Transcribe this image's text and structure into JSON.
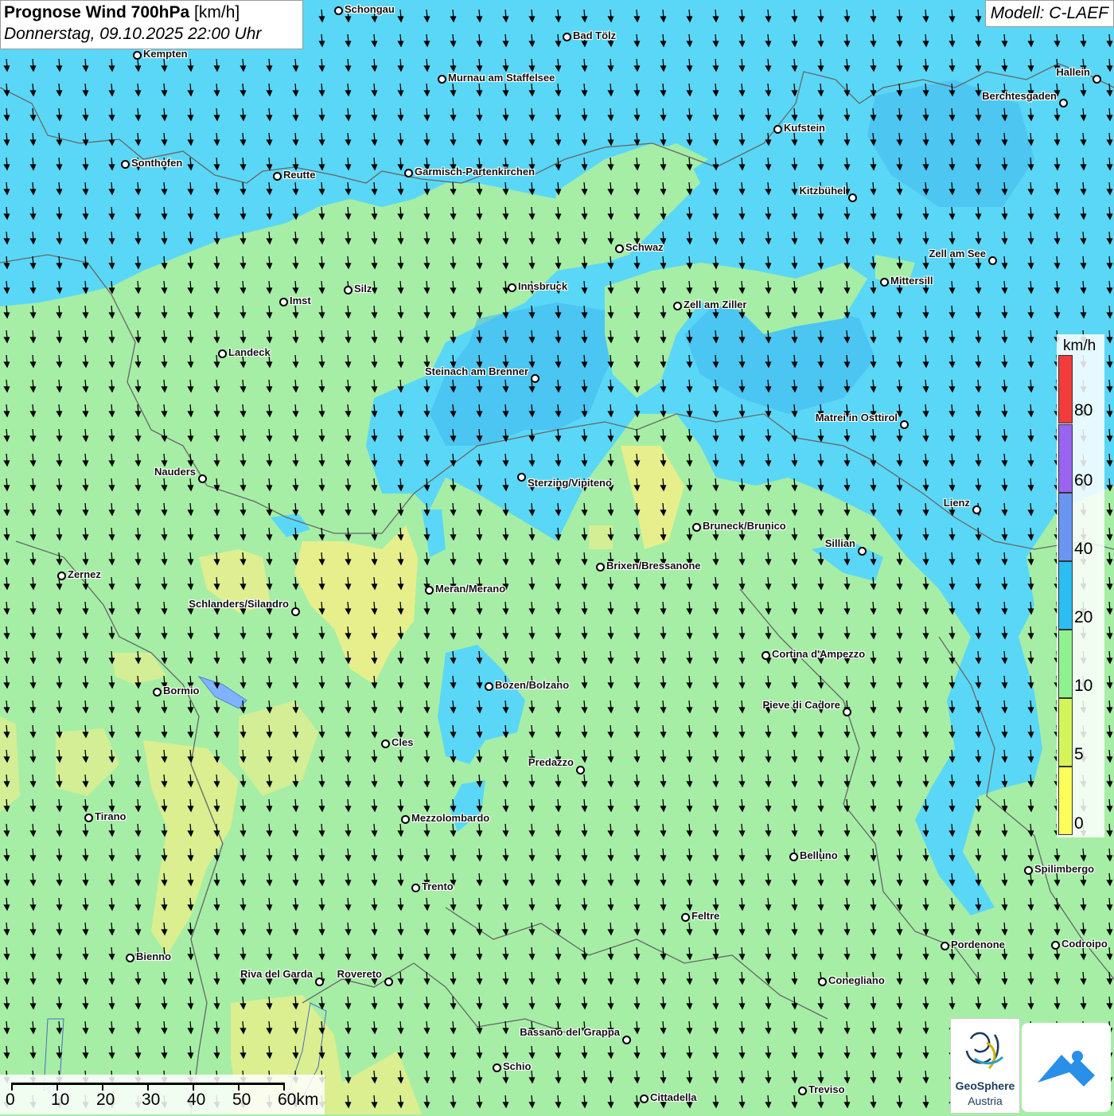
{
  "header": {
    "title_bold": "Prognose Wind 700hPa",
    "title_unit": " [km/h]",
    "datetime": "Donnerstag, 09.10.2025 22:00 Uhr",
    "model": "Modell: C-LAEF"
  },
  "legend": {
    "unit": "km/h",
    "ticks": [
      "80",
      "60",
      "40",
      "20",
      "10",
      "5",
      "0"
    ],
    "colors": [
      "#f23c3c",
      "#9a63f0",
      "#6a96f2",
      "#2bbef2",
      "#8ff28f",
      "#d4f55a",
      "#ffff5a"
    ]
  },
  "scalebar": {
    "labels": [
      "0",
      "10",
      "20",
      "30",
      "40",
      "50",
      "60km"
    ]
  },
  "logos": {
    "geosphere_line1": "GeoSphere",
    "geosphere_line2": "Austria"
  },
  "colors": {
    "calm_yellow": "#f2ee88",
    "light_green": "#a6eea6",
    "sky_blue": "#5ad7f7",
    "mid_blue": "#3fb6ee",
    "border_gray": "#666666",
    "arrow": "#000000"
  },
  "wind_direction": "north-to-south",
  "cities": [
    {
      "name": "Schongau"
    },
    {
      "name": "Bad Tölz"
    },
    {
      "name": "Kempten"
    },
    {
      "name": "Murnau am Staffelsee"
    },
    {
      "name": "Hallein"
    },
    {
      "name": "Berchtesgaden"
    },
    {
      "name": "Kufstein"
    },
    {
      "name": "Sonthofen"
    },
    {
      "name": "Reutte"
    },
    {
      "name": "Garmisch-Partenkirchen"
    },
    {
      "name": "Kitzbühel"
    },
    {
      "name": "Schwaz"
    },
    {
      "name": "Zell am See"
    },
    {
      "name": "Mittersill"
    },
    {
      "name": "Innsbruck"
    },
    {
      "name": "Silz"
    },
    {
      "name": "Imst"
    },
    {
      "name": "Zell am Ziller"
    },
    {
      "name": "Landeck"
    },
    {
      "name": "Steinach am Brenner"
    },
    {
      "name": "Matrei in Osttirol"
    },
    {
      "name": "Nauders"
    },
    {
      "name": "Sterzing/Vipiteno"
    },
    {
      "name": "Lienz"
    },
    {
      "name": "Bruneck/Brunico"
    },
    {
      "name": "Sillian"
    },
    {
      "name": "Brixen/Bressanone"
    },
    {
      "name": "Zernez"
    },
    {
      "name": "Meran/Merano"
    },
    {
      "name": "Schlanders/Silandro"
    },
    {
      "name": "Cortina d'Ampezzo"
    },
    {
      "name": "Bozen/Bolzano"
    },
    {
      "name": "Bormio"
    },
    {
      "name": "Pieve di Cadore"
    },
    {
      "name": "Cles"
    },
    {
      "name": "Predazzo"
    },
    {
      "name": "Tirano"
    },
    {
      "name": "Mezzolombardo"
    },
    {
      "name": "Belluno"
    },
    {
      "name": "Spilimbergo"
    },
    {
      "name": "Trento"
    },
    {
      "name": "Feltre"
    },
    {
      "name": "Pordenone"
    },
    {
      "name": "Codroipo"
    },
    {
      "name": "Bienno"
    },
    {
      "name": "Riva del Garda"
    },
    {
      "name": "Rovereto"
    },
    {
      "name": "Conegliano"
    },
    {
      "name": "Bassano del Grappa"
    },
    {
      "name": "Schio"
    },
    {
      "name": "Treviso"
    },
    {
      "name": "Cittadella"
    }
  ]
}
